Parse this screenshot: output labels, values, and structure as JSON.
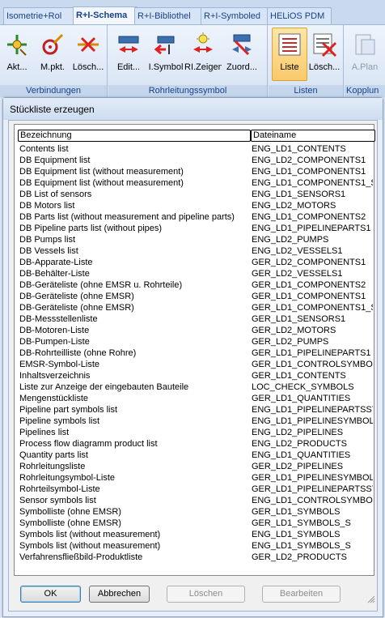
{
  "tabs": [
    "Isometrie+Rol",
    "R+I-Schema",
    "R+I-Bibliothel",
    "R+I-Symboled",
    "HELiOS PDM"
  ],
  "ribbon": {
    "groups": {
      "verbindungen": "Verbindungen",
      "rohrleitungssymbol": "Rohrleitungssymbol",
      "listen": "Listen",
      "kopplung": "Kopplun"
    },
    "buttons": {
      "akt": "Akt...",
      "mpkt": "M.pkt.",
      "loesch1": "Lösch...",
      "edit": "Edit...",
      "isymbol": "I.Symbol",
      "rizeigen": "RI.Zeigen",
      "zuord": "Zuord...",
      "liste": "Liste",
      "loesch2": "Lösch...",
      "aplan": "A.Plan"
    }
  },
  "dialog": {
    "title": "Stückliste erzeugen",
    "columns": {
      "name": "Bezeichnung",
      "file": "Dateiname"
    },
    "rows": [
      [
        "Contents list",
        "ENG_LD1_CONTENTS"
      ],
      [
        "DB Equipment list",
        "ENG_LD2_COMPONENTS1"
      ],
      [
        "DB Equipment list (without measurement)",
        "ENG_LD1_COMPONENTS1"
      ],
      [
        "DB Equipment list (without measurement)",
        "ENG_LD1_COMPONENTS1_S"
      ],
      [
        "DB List of sensors",
        "ENG_LD1_SENSORS1"
      ],
      [
        "DB Motors list",
        "ENG_LD2_MOTORS"
      ],
      [
        "DB Parts list (without measurement and pipeline parts)",
        "ENG_LD1_COMPONENTS2"
      ],
      [
        "DB Pipeline parts list (without pipes)",
        "ENG_LD1_PIPELINEPARTS1"
      ],
      [
        "DB Pumps list",
        "ENG_LD2_PUMPS"
      ],
      [
        "DB Vessels list",
        "ENG_LD2_VESSELS1"
      ],
      [
        "DB-Apparate-Liste",
        "GER_LD2_COMPONENTS1"
      ],
      [
        "DB-Behälter-Liste",
        "GER_LD2_VESSELS1"
      ],
      [
        "DB-Geräteliste (ohne EMSR u. Rohrteile)",
        "GER_LD1_COMPONENTS2"
      ],
      [
        "DB-Geräteliste (ohne EMSR)",
        "GER_LD1_COMPONENTS1"
      ],
      [
        "DB-Geräteliste (ohne EMSR)",
        "GER_LD1_COMPONENTS1_S"
      ],
      [
        "DB-Messstellenliste",
        "GER_LD1_SENSORS1"
      ],
      [
        "DB-Motoren-Liste",
        "GER_LD2_MOTORS"
      ],
      [
        "DB-Pumpen-Liste",
        "GER_LD2_PUMPS"
      ],
      [
        "DB-Rohrteilliste (ohne Rohre)",
        "GER_LD1_PIPELINEPARTS1"
      ],
      [
        "EMSR-Symbol-Liste",
        "GER_LD1_CONTROLSYMBOLS"
      ],
      [
        "Inhaltsverzeichnis",
        "GER_LD1_CONTENTS"
      ],
      [
        "Liste zur Anzeige der eingebauten Bauteile",
        "LOC_CHECK_SYMBOLS"
      ],
      [
        "Mengenstückliste",
        "GER_LD1_QUANTITIES"
      ],
      [
        "Pipeline part symbols list",
        "ENG_LD1_PIPELINEPARTSSYM"
      ],
      [
        "Pipeline symbols list",
        "ENG_LD1_PIPELINESYMBOLS"
      ],
      [
        "Pipelines list",
        "ENG_LD2_PIPELINES"
      ],
      [
        "Process flow diagramm product list",
        "ENG_LD2_PRODUCTS"
      ],
      [
        "Quantity parts list",
        "ENG_LD1_QUANTITIES"
      ],
      [
        "Rohrleitungsliste",
        "GER_LD2_PIPELINES"
      ],
      [
        "Rohrleitungsymbol-Liste",
        "GER_LD1_PIPELINESYMBOLS"
      ],
      [
        "Rohrteilsymbol-Liste",
        "GER_LD1_PIPELINEPARTSSYM"
      ],
      [
        "Sensor symbols list",
        "ENG_LD1_CONTROLSYMBOLS"
      ],
      [
        "Symbolliste (ohne EMSR)",
        "GER_LD1_SYMBOLS"
      ],
      [
        "Symbolliste (ohne EMSR)",
        "GER_LD1_SYMBOLS_S"
      ],
      [
        "Symbols list (without measurement)",
        "ENG_LD1_SYMBOLS"
      ],
      [
        "Symbols list (without measurement)",
        "ENG_LD1_SYMBOLS_S"
      ],
      [
        "Verfahrensfließbild-Produktliste",
        "GER_LD2_PRODUCTS"
      ]
    ],
    "buttons": {
      "ok": "OK",
      "cancel": "Abbrechen",
      "delete": "Löschen",
      "edit": "Bearbeiten"
    }
  },
  "colors": {
    "accent": "#15428b",
    "ribbon": "#dfe9f5",
    "selected": "#fbc96a"
  }
}
